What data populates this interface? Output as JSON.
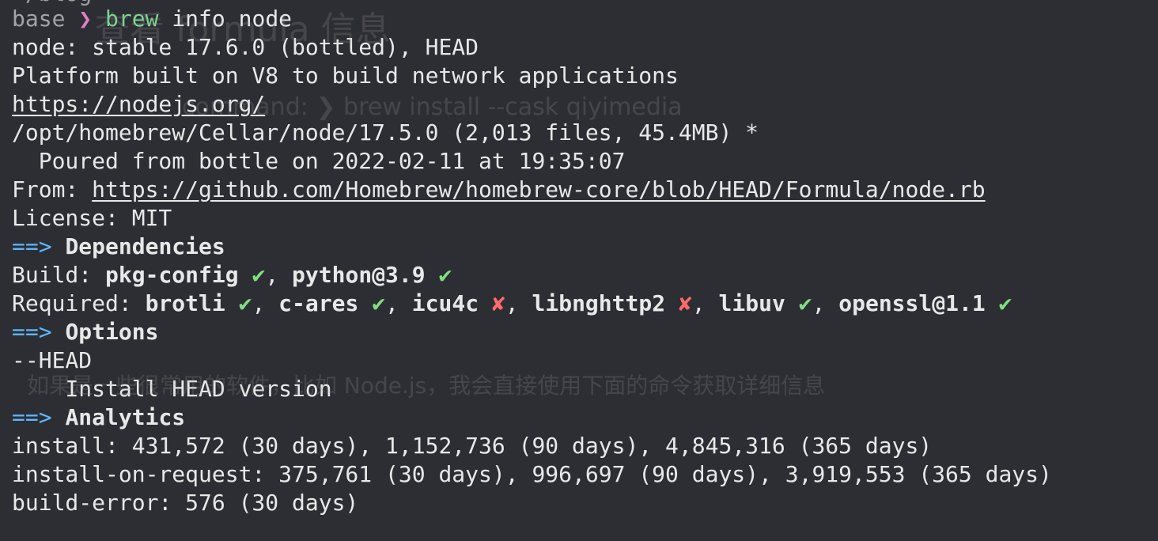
{
  "top_fragment": "~/blog",
  "prompt": {
    "env": "base",
    "symbol": "❯",
    "command": "brew",
    "args": " info node"
  },
  "info": {
    "node_line": "node: stable 17.6.0 (bottled), HEAD",
    "description": "Platform built on V8 to build network applications",
    "homepage": "https://nodejs.org/",
    "cellar": "/opt/homebrew/Cellar/node/17.5.0 (2,013 files, 45.4MB) *",
    "poured": "  Poured from bottle on 2022-02-11 at 19:35:07",
    "from_label": "From: ",
    "from_url": "https://github.com/Homebrew/homebrew-core/blob/HEAD/Formula/node.rb",
    "license": "License: MIT"
  },
  "arrow": "==>",
  "sections": {
    "dependencies": "Dependencies",
    "options": "Options",
    "analytics": "Analytics"
  },
  "build": {
    "label": "Build: ",
    "deps": [
      {
        "name": "pkg-config",
        "mark": "✔",
        "status": "ok",
        "sep": ", "
      },
      {
        "name": "python@3.9",
        "mark": "✔",
        "status": "ok",
        "sep": ""
      }
    ]
  },
  "required": {
    "label": "Required: ",
    "deps": [
      {
        "name": "brotli",
        "mark": "✔",
        "status": "ok",
        "sep": ", "
      },
      {
        "name": "c-ares",
        "mark": "✔",
        "status": "ok",
        "sep": ", "
      },
      {
        "name": "icu4c",
        "mark": "✘",
        "status": "missing",
        "sep": ", "
      },
      {
        "name": "libnghttp2",
        "mark": "✘",
        "status": "missing",
        "sep": ", "
      },
      {
        "name": "libuv",
        "mark": "✔",
        "status": "ok",
        "sep": ", "
      },
      {
        "name": "openssl@1.1",
        "mark": "✔",
        "status": "ok",
        "sep": ""
      }
    ]
  },
  "options": {
    "flag": "--HEAD",
    "desc": "\tInstall HEAD version"
  },
  "analytics": {
    "install": "install: 431,572 (30 days), 1,152,736 (90 days), 4,845,316 (365 days)",
    "install_on_request": "install-on-request: 375,761 (30 days), 996,697 (90 days), 3,919,553 (365 days)",
    "build_error": "build-error: 576 (30 days)"
  },
  "background_ghost": {
    "heading": "查看 formula 信息",
    "command": "command: ❯ brew install --cask qiyimedia",
    "paragraph": "如果是一些很常用的软件，比如 Node.js，我会直接使用下面的命令获取详细信息"
  },
  "colors": {
    "background": "#2d2e33",
    "text": "#e8e8e8",
    "arrow": "#5fb7ff",
    "ok": "#7ee07e",
    "missing": "#ff6b6b",
    "prompt_symbol": "#e07fc7",
    "command": "#78d98f"
  }
}
